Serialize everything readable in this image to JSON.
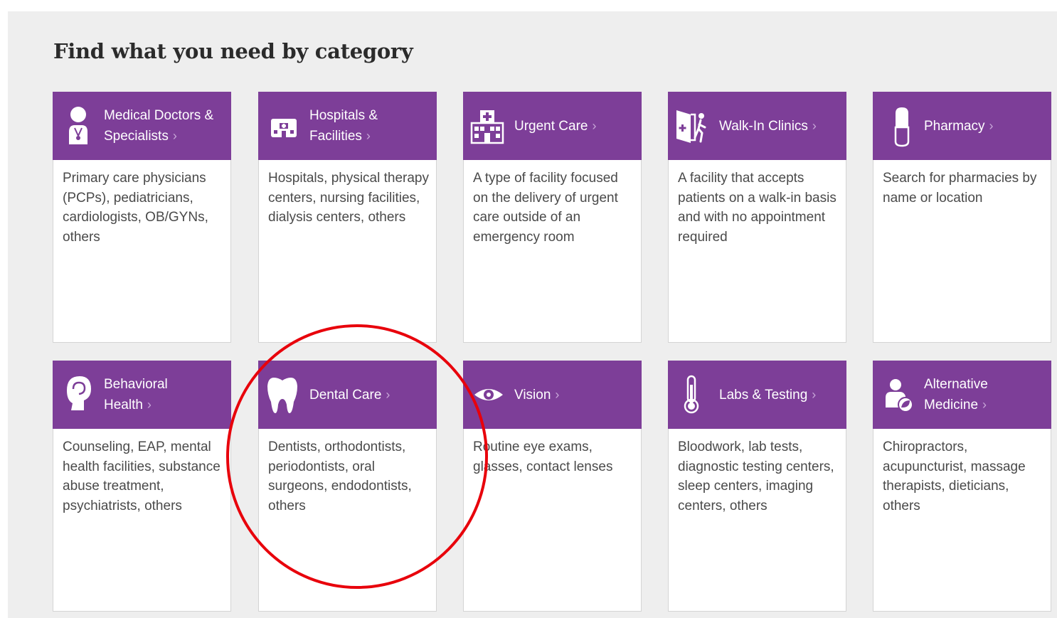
{
  "page": {
    "title": "Find what you need by category"
  },
  "categories": [
    {
      "title_line1": "Medical Doctors &",
      "title_line2": "Specialists",
      "icon": "doctor-icon",
      "description": "Primary care physicians (PCPs), pediatricians, cardiologists, OB/GYNs, others"
    },
    {
      "title_line1": "Hospitals &",
      "title_line2": "Facilities",
      "icon": "hospital-building-icon",
      "description": "Hospitals, physical therapy centers, nursing facilities, dialysis centers, others"
    },
    {
      "title_line1": "Urgent Care",
      "title_line2": "",
      "icon": "urgent-care-building-icon",
      "description": "A type of facility focused on the delivery of urgent care outside of an emergency room"
    },
    {
      "title_line1": "Walk-In Clinics",
      "title_line2": "",
      "icon": "walk-in-door-icon",
      "description": "A facility that accepts patients on a walk-in basis and with no appointment required"
    },
    {
      "title_line1": "Pharmacy",
      "title_line2": "",
      "icon": "pill-capsule-icon",
      "description": "Search for pharmacies by name or location"
    },
    {
      "title_line1": "Behavioral",
      "title_line2": "Health",
      "icon": "head-mind-icon",
      "description": "Counseling, EAP, mental health facilities, substance abuse treatment, psychiatrists, others"
    },
    {
      "title_line1": "Dental Care",
      "title_line2": "",
      "icon": "tooth-icon",
      "description": "Dentists, orthodontists, periodontists, oral surgeons, endodontists, others"
    },
    {
      "title_line1": "Vision",
      "title_line2": "",
      "icon": "eye-icon",
      "description": "Routine eye exams, glasses, contact lenses"
    },
    {
      "title_line1": "Labs & Testing",
      "title_line2": "",
      "icon": "thermometer-icon",
      "description": "Bloodwork, lab tests, diagnostic testing centers, sleep centers, imaging centers, others"
    },
    {
      "title_line1": "Alternative",
      "title_line2": "Medicine",
      "icon": "alternative-medicine-icon",
      "description": "Chiropractors, acupuncturist, massage therapists, dieticians, others"
    }
  ],
  "chevron": "›",
  "colors": {
    "header_purple": "#7d3e98",
    "annotation_red": "#e8000b",
    "panel_gray": "#eeeeee"
  }
}
